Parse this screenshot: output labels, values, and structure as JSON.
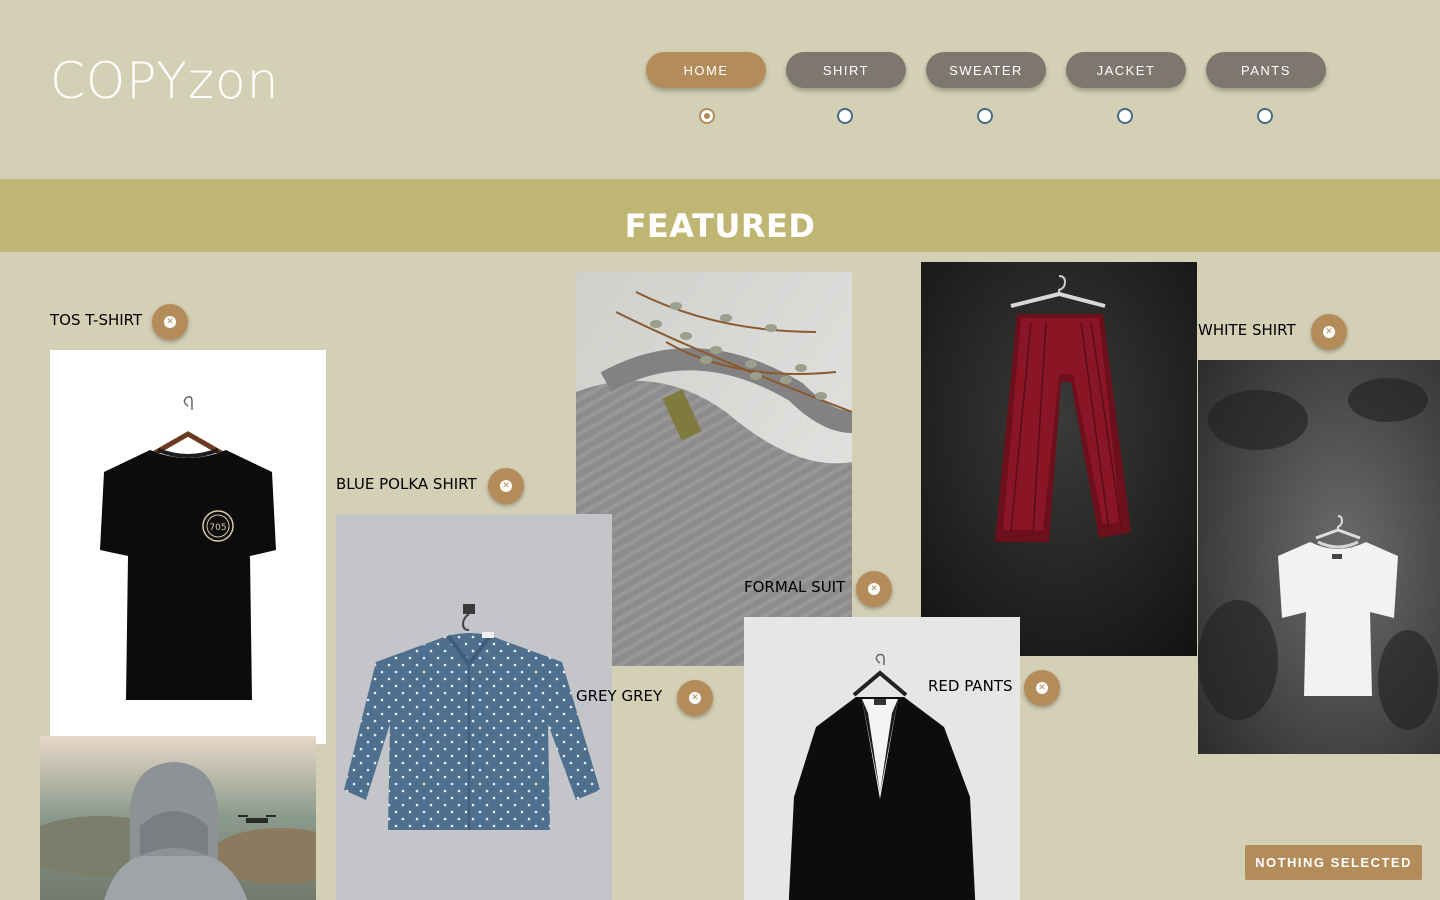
{
  "app": {
    "logo": "COPYzon"
  },
  "nav": {
    "items": [
      {
        "label": "HOME"
      },
      {
        "label": "SHIRT"
      },
      {
        "label": "SWEATER"
      },
      {
        "label": "JACKET"
      },
      {
        "label": "PANTS"
      }
    ],
    "selected": "HOME"
  },
  "banner": {
    "title": "FEATURED"
  },
  "products": [
    {
      "name": "TOS T-SHIRT",
      "image": "black-tshirt"
    },
    {
      "name": "BLUE POLKA SHIRT",
      "image": "blue-polka-shirt"
    },
    {
      "name": "GREY GREY",
      "image": "grey-sweater"
    },
    {
      "name": "FORMAL SUIT",
      "image": "black-suit"
    },
    {
      "name": "RED PANTS",
      "image": "red-pants"
    },
    {
      "name": "WHITE SHIRT",
      "image": "white-tshirt"
    }
  ],
  "icons": {
    "remove": "close-circle-icon"
  },
  "status": {
    "text": "NOTHING SELECTED"
  },
  "colors": {
    "background": "#d4d0b6",
    "banner": "#c0b673",
    "accent": "#b48c5a",
    "nav_inactive": "#7d7770"
  }
}
